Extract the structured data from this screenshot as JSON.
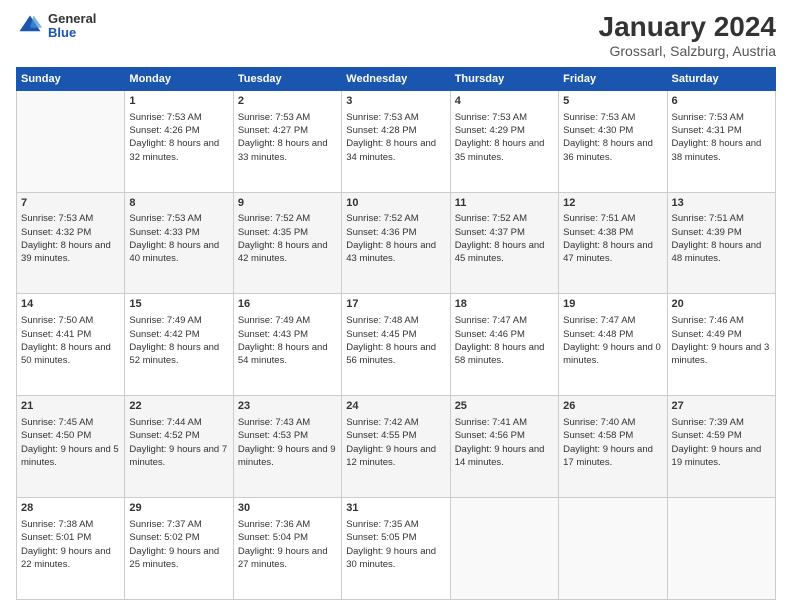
{
  "header": {
    "logo_general": "General",
    "logo_blue": "Blue",
    "title": "January 2024",
    "subtitle": "Grossarl, Salzburg, Austria"
  },
  "weekdays": [
    "Sunday",
    "Monday",
    "Tuesday",
    "Wednesday",
    "Thursday",
    "Friday",
    "Saturday"
  ],
  "weeks": [
    [
      {
        "day": "",
        "sunrise": "",
        "sunset": "",
        "daylight": ""
      },
      {
        "day": "1",
        "sunrise": "Sunrise: 7:53 AM",
        "sunset": "Sunset: 4:26 PM",
        "daylight": "Daylight: 8 hours and 32 minutes."
      },
      {
        "day": "2",
        "sunrise": "Sunrise: 7:53 AM",
        "sunset": "Sunset: 4:27 PM",
        "daylight": "Daylight: 8 hours and 33 minutes."
      },
      {
        "day": "3",
        "sunrise": "Sunrise: 7:53 AM",
        "sunset": "Sunset: 4:28 PM",
        "daylight": "Daylight: 8 hours and 34 minutes."
      },
      {
        "day": "4",
        "sunrise": "Sunrise: 7:53 AM",
        "sunset": "Sunset: 4:29 PM",
        "daylight": "Daylight: 8 hours and 35 minutes."
      },
      {
        "day": "5",
        "sunrise": "Sunrise: 7:53 AM",
        "sunset": "Sunset: 4:30 PM",
        "daylight": "Daylight: 8 hours and 36 minutes."
      },
      {
        "day": "6",
        "sunrise": "Sunrise: 7:53 AM",
        "sunset": "Sunset: 4:31 PM",
        "daylight": "Daylight: 8 hours and 38 minutes."
      }
    ],
    [
      {
        "day": "7",
        "sunrise": "Sunrise: 7:53 AM",
        "sunset": "Sunset: 4:32 PM",
        "daylight": "Daylight: 8 hours and 39 minutes."
      },
      {
        "day": "8",
        "sunrise": "Sunrise: 7:53 AM",
        "sunset": "Sunset: 4:33 PM",
        "daylight": "Daylight: 8 hours and 40 minutes."
      },
      {
        "day": "9",
        "sunrise": "Sunrise: 7:52 AM",
        "sunset": "Sunset: 4:35 PM",
        "daylight": "Daylight: 8 hours and 42 minutes."
      },
      {
        "day": "10",
        "sunrise": "Sunrise: 7:52 AM",
        "sunset": "Sunset: 4:36 PM",
        "daylight": "Daylight: 8 hours and 43 minutes."
      },
      {
        "day": "11",
        "sunrise": "Sunrise: 7:52 AM",
        "sunset": "Sunset: 4:37 PM",
        "daylight": "Daylight: 8 hours and 45 minutes."
      },
      {
        "day": "12",
        "sunrise": "Sunrise: 7:51 AM",
        "sunset": "Sunset: 4:38 PM",
        "daylight": "Daylight: 8 hours and 47 minutes."
      },
      {
        "day": "13",
        "sunrise": "Sunrise: 7:51 AM",
        "sunset": "Sunset: 4:39 PM",
        "daylight": "Daylight: 8 hours and 48 minutes."
      }
    ],
    [
      {
        "day": "14",
        "sunrise": "Sunrise: 7:50 AM",
        "sunset": "Sunset: 4:41 PM",
        "daylight": "Daylight: 8 hours and 50 minutes."
      },
      {
        "day": "15",
        "sunrise": "Sunrise: 7:49 AM",
        "sunset": "Sunset: 4:42 PM",
        "daylight": "Daylight: 8 hours and 52 minutes."
      },
      {
        "day": "16",
        "sunrise": "Sunrise: 7:49 AM",
        "sunset": "Sunset: 4:43 PM",
        "daylight": "Daylight: 8 hours and 54 minutes."
      },
      {
        "day": "17",
        "sunrise": "Sunrise: 7:48 AM",
        "sunset": "Sunset: 4:45 PM",
        "daylight": "Daylight: 8 hours and 56 minutes."
      },
      {
        "day": "18",
        "sunrise": "Sunrise: 7:47 AM",
        "sunset": "Sunset: 4:46 PM",
        "daylight": "Daylight: 8 hours and 58 minutes."
      },
      {
        "day": "19",
        "sunrise": "Sunrise: 7:47 AM",
        "sunset": "Sunset: 4:48 PM",
        "daylight": "Daylight: 9 hours and 0 minutes."
      },
      {
        "day": "20",
        "sunrise": "Sunrise: 7:46 AM",
        "sunset": "Sunset: 4:49 PM",
        "daylight": "Daylight: 9 hours and 3 minutes."
      }
    ],
    [
      {
        "day": "21",
        "sunrise": "Sunrise: 7:45 AM",
        "sunset": "Sunset: 4:50 PM",
        "daylight": "Daylight: 9 hours and 5 minutes."
      },
      {
        "day": "22",
        "sunrise": "Sunrise: 7:44 AM",
        "sunset": "Sunset: 4:52 PM",
        "daylight": "Daylight: 9 hours and 7 minutes."
      },
      {
        "day": "23",
        "sunrise": "Sunrise: 7:43 AM",
        "sunset": "Sunset: 4:53 PM",
        "daylight": "Daylight: 9 hours and 9 minutes."
      },
      {
        "day": "24",
        "sunrise": "Sunrise: 7:42 AM",
        "sunset": "Sunset: 4:55 PM",
        "daylight": "Daylight: 9 hours and 12 minutes."
      },
      {
        "day": "25",
        "sunrise": "Sunrise: 7:41 AM",
        "sunset": "Sunset: 4:56 PM",
        "daylight": "Daylight: 9 hours and 14 minutes."
      },
      {
        "day": "26",
        "sunrise": "Sunrise: 7:40 AM",
        "sunset": "Sunset: 4:58 PM",
        "daylight": "Daylight: 9 hours and 17 minutes."
      },
      {
        "day": "27",
        "sunrise": "Sunrise: 7:39 AM",
        "sunset": "Sunset: 4:59 PM",
        "daylight": "Daylight: 9 hours and 19 minutes."
      }
    ],
    [
      {
        "day": "28",
        "sunrise": "Sunrise: 7:38 AM",
        "sunset": "Sunset: 5:01 PM",
        "daylight": "Daylight: 9 hours and 22 minutes."
      },
      {
        "day": "29",
        "sunrise": "Sunrise: 7:37 AM",
        "sunset": "Sunset: 5:02 PM",
        "daylight": "Daylight: 9 hours and 25 minutes."
      },
      {
        "day": "30",
        "sunrise": "Sunrise: 7:36 AM",
        "sunset": "Sunset: 5:04 PM",
        "daylight": "Daylight: 9 hours and 27 minutes."
      },
      {
        "day": "31",
        "sunrise": "Sunrise: 7:35 AM",
        "sunset": "Sunset: 5:05 PM",
        "daylight": "Daylight: 9 hours and 30 minutes."
      },
      {
        "day": "",
        "sunrise": "",
        "sunset": "",
        "daylight": ""
      },
      {
        "day": "",
        "sunrise": "",
        "sunset": "",
        "daylight": ""
      },
      {
        "day": "",
        "sunrise": "",
        "sunset": "",
        "daylight": ""
      }
    ]
  ]
}
